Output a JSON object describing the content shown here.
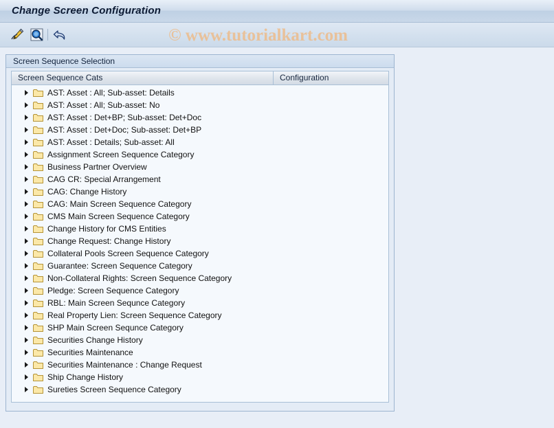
{
  "window": {
    "title": "Change Screen Configuration"
  },
  "toolbar": {
    "buttons": [
      {
        "name": "change-edit-button",
        "icon": "pencil-edit-icon",
        "tooltip": "Change"
      },
      {
        "name": "display-button",
        "icon": "magnifier-display-icon",
        "tooltip": "Display"
      },
      {
        "name": "back-button",
        "icon": "back-arrow-icon",
        "tooltip": "Back"
      }
    ]
  },
  "watermark": {
    "text": "© www.tutorialkart.com"
  },
  "panel": {
    "title": "Screen Sequence Selection"
  },
  "tree": {
    "columns": [
      {
        "label": "Screen Sequence Cats"
      },
      {
        "label": "Configuration"
      }
    ],
    "rows": [
      {
        "label": "AST: Asset : All; Sub-asset: Details",
        "configuration": ""
      },
      {
        "label": "AST: Asset : All; Sub-asset: No",
        "configuration": ""
      },
      {
        "label": "AST: Asset : Det+BP; Sub-asset: Det+Doc",
        "configuration": ""
      },
      {
        "label": "AST: Asset : Det+Doc; Sub-asset: Det+BP",
        "configuration": ""
      },
      {
        "label": "AST: Asset : Details; Sub-asset: All",
        "configuration": ""
      },
      {
        "label": "Assignment Screen Sequence Category",
        "configuration": ""
      },
      {
        "label": "Business Partner Overview",
        "configuration": ""
      },
      {
        "label": "CAG CR: Special Arrangement",
        "configuration": ""
      },
      {
        "label": "CAG: Change History",
        "configuration": ""
      },
      {
        "label": "CAG: Main Screen Sequence Category",
        "configuration": ""
      },
      {
        "label": "CMS Main Screen Sequence Category",
        "configuration": ""
      },
      {
        "label": "Change History for CMS Entities",
        "configuration": ""
      },
      {
        "label": "Change Request: Change History",
        "configuration": ""
      },
      {
        "label": "Collateral Pools Screen Sequence Category",
        "configuration": ""
      },
      {
        "label": "Guarantee: Screen Sequence Category",
        "configuration": ""
      },
      {
        "label": "Non-Collateral Rights: Screen Sequence Category",
        "configuration": ""
      },
      {
        "label": "Pledge: Screen Sequence Category",
        "configuration": ""
      },
      {
        "label": "RBL: Main Screen Sequnce Category",
        "configuration": ""
      },
      {
        "label": "Real Property Lien: Screen Sequence Category",
        "configuration": ""
      },
      {
        "label": "SHP Main Screen Sequnce Category",
        "configuration": ""
      },
      {
        "label": "Securities Change History",
        "configuration": ""
      },
      {
        "label": "Securities Maintenance",
        "configuration": ""
      },
      {
        "label": "Securities Maintenance : Change Request",
        "configuration": ""
      },
      {
        "label": "Ship Change History",
        "configuration": ""
      },
      {
        "label": "Sureties Screen Sequence Category",
        "configuration": ""
      }
    ]
  },
  "colors": {
    "title_text": "#0c1a33",
    "watermark": "#f0b77e",
    "folder_fill": "#fbe8a8",
    "folder_border": "#b59335",
    "panel_border": "#9cb4d0",
    "tree_background": "#f5f9fd",
    "page_background": "#e8eef7"
  }
}
